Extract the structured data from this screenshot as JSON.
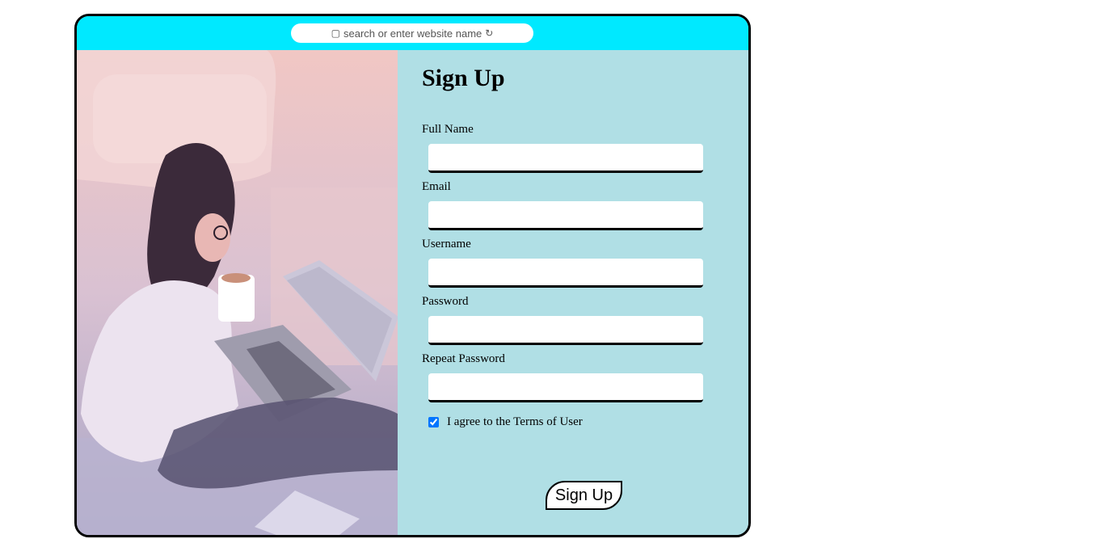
{
  "browser": {
    "address_placeholder": "search or enter website name",
    "address_left_icon": "square-icon",
    "address_right_icon": "refresh-icon",
    "accent_color": "#00e9ff",
    "panel_color": "#b0dfe5"
  },
  "form": {
    "title": "Sign Up",
    "fields": [
      {
        "label": "Full Name",
        "value": ""
      },
      {
        "label": "Email",
        "value": ""
      },
      {
        "label": "Username",
        "value": ""
      },
      {
        "label": "Password",
        "value": ""
      },
      {
        "label": "Repeat Password",
        "value": ""
      }
    ],
    "agree_label": "I agree to the Terms of User",
    "agree_checked": true,
    "submit_label": "Sign Up"
  }
}
